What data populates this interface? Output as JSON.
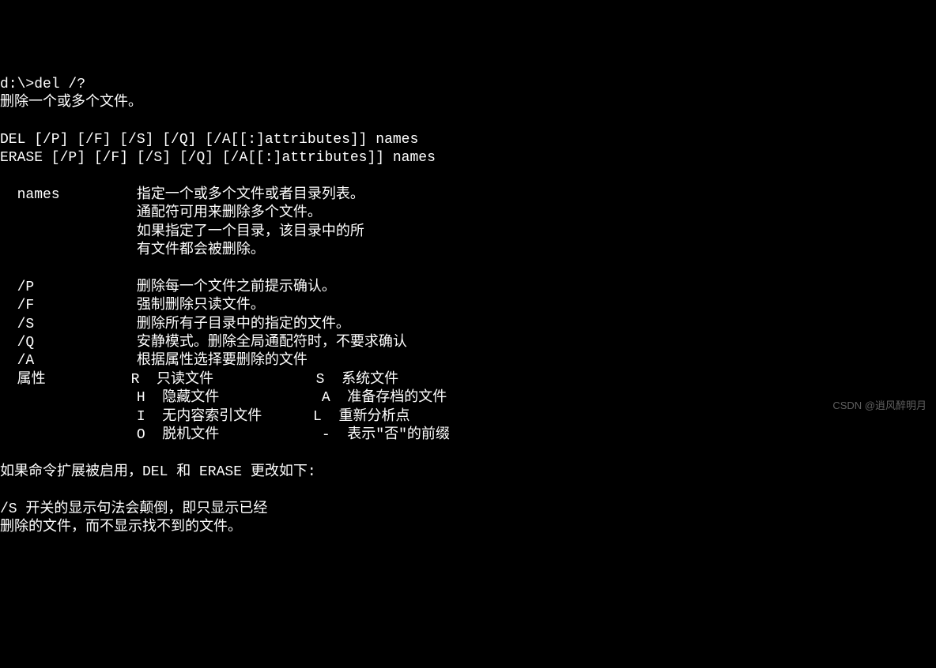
{
  "prompt": "d:\\>del /?",
  "description": "删除一个或多个文件。",
  "syntax1": "DEL [/P] [/F] [/S] [/Q] [/A[[:]attributes]] names",
  "syntax2": "ERASE [/P] [/F] [/S] [/Q] [/A[[:]attributes]] names",
  "names_label": "  names",
  "names_desc1": "指定一个或多个文件或者目录列表。",
  "names_desc2": "通配符可用来删除多个文件。",
  "names_desc3": "如果指定了一个目录，该目录中的所",
  "names_desc4": "有文件都会被删除。",
  "opt_p_label": "  /P",
  "opt_p_desc": "删除每一个文件之前提示确认。",
  "opt_f_label": "  /F",
  "opt_f_desc": "强制删除只读文件。",
  "opt_s_label": "  /S",
  "opt_s_desc": "删除所有子目录中的指定的文件。",
  "opt_q_label": "  /Q",
  "opt_q_desc": "安静模式。删除全局通配符时，不要求确认",
  "opt_a_label": "  /A",
  "opt_a_desc": "根据属性选择要删除的文件",
  "attr_label": "  属性",
  "attr_r": "R  只读文件",
  "attr_s": "S  系统文件",
  "attr_h": "H  隐藏文件",
  "attr_a": "A  准备存档的文件",
  "attr_i": "I  无内容索引文件",
  "attr_l": "L  重新分析点",
  "attr_o": "O  脱机文件",
  "attr_neg": "-  表示\"否\"的前缀",
  "ext_note": "如果命令扩展被启用，DEL 和 ERASE 更改如下:",
  "s_note1": "/S 开关的显示句法会颠倒，即只显示已经",
  "s_note2": "删除的文件，而不显示找不到的文件。",
  "watermark": "CSDN @逍风醉明月"
}
